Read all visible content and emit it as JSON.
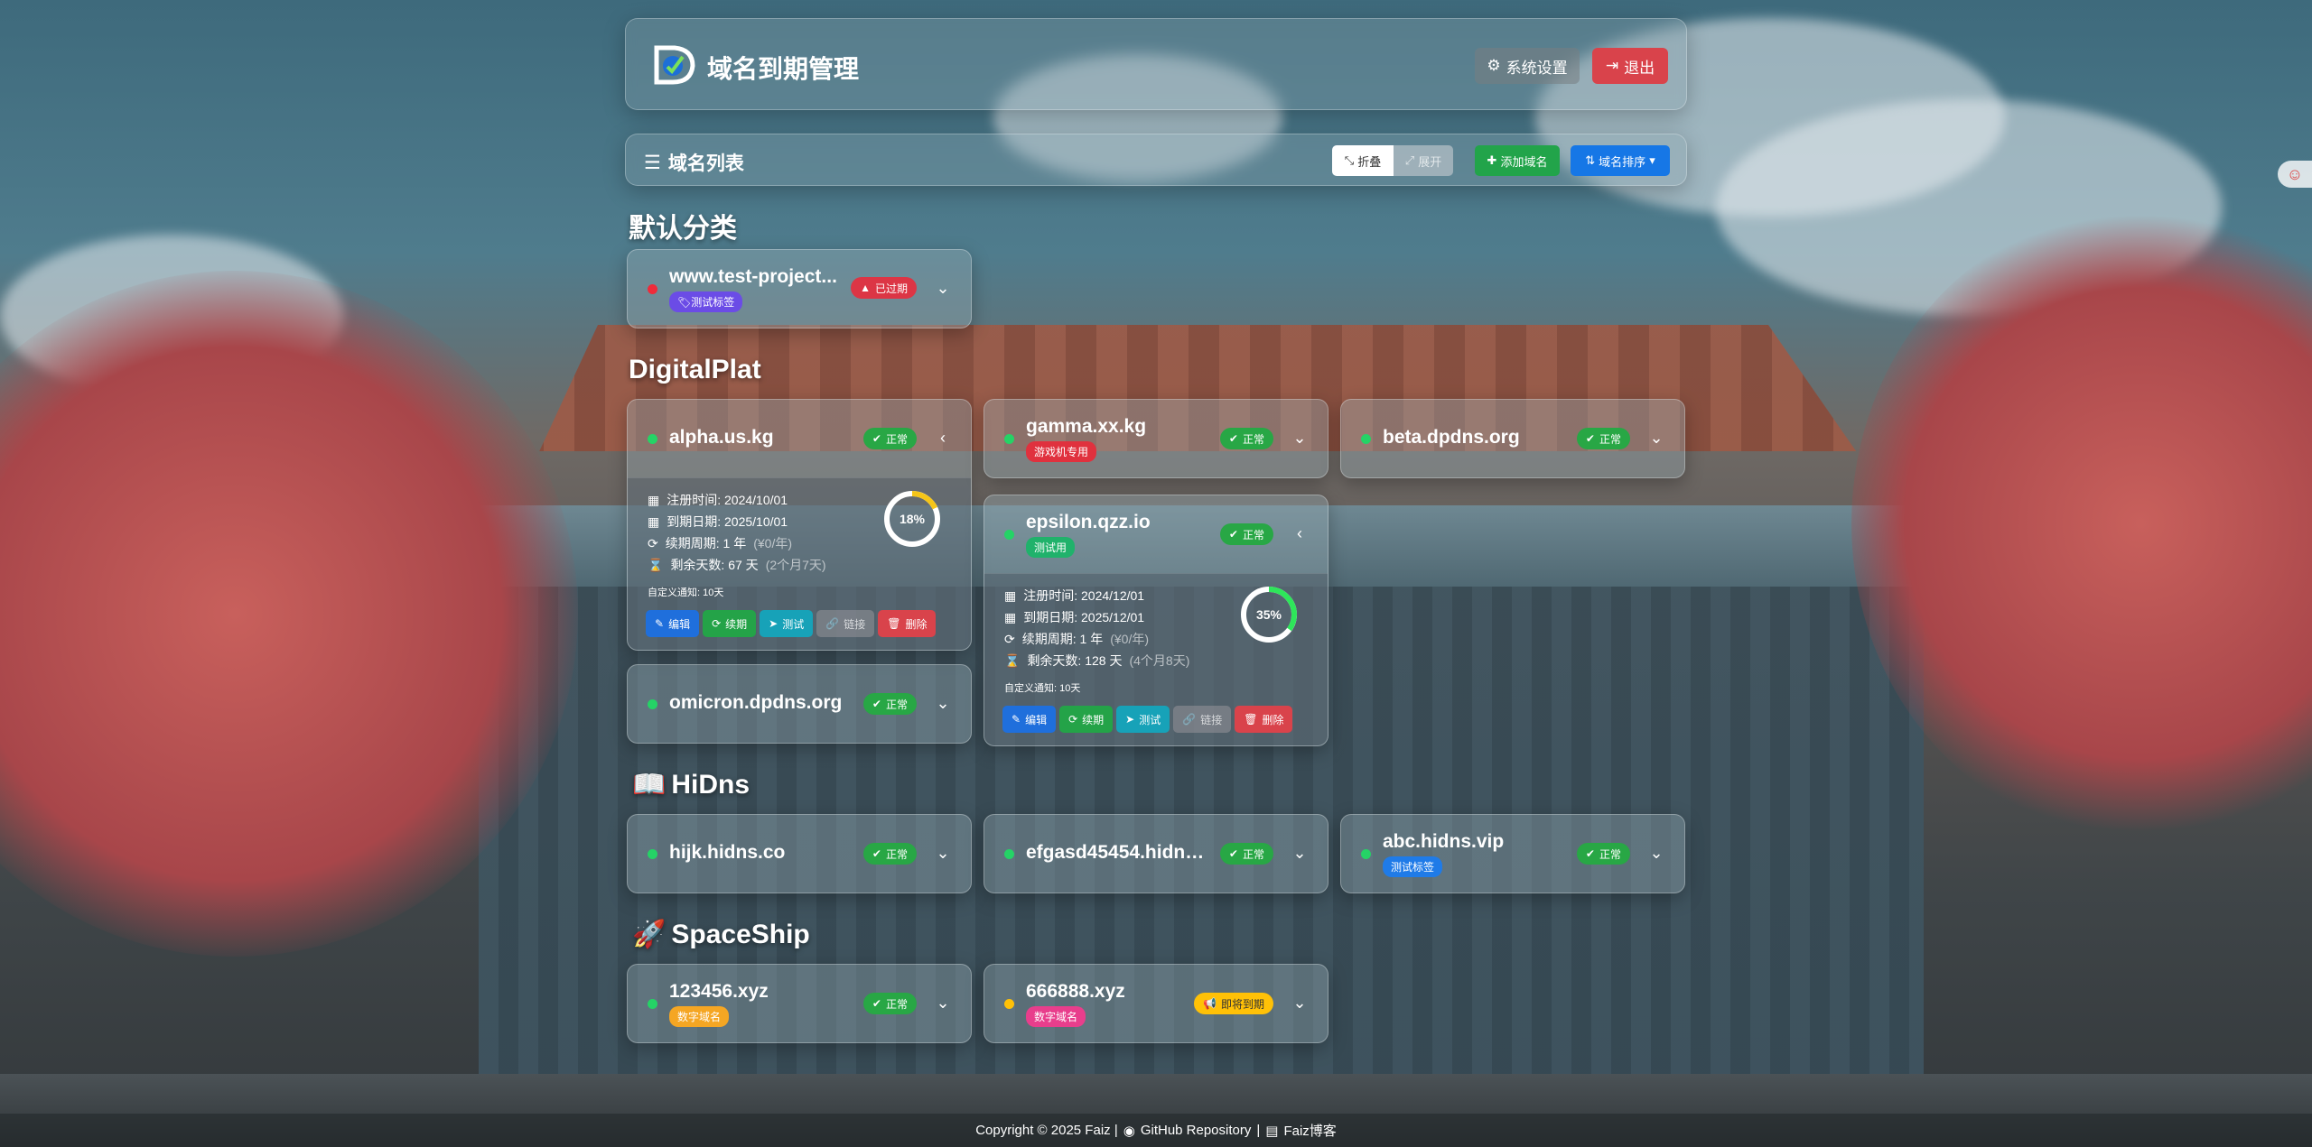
{
  "header": {
    "title": "域名到期管理",
    "settings_label": "系统设置",
    "logout_label": "退出"
  },
  "listbar": {
    "title": "域名列表",
    "collapse_label": "折叠",
    "expand_label": "展开",
    "add_label": "添加域名",
    "sort_label": "域名排序"
  },
  "categories": [
    {
      "name": "默认分类",
      "icon": ""
    },
    {
      "name": "DigitalPlat",
      "icon": ""
    },
    {
      "name": "HiDns",
      "icon": "book-icon"
    },
    {
      "name": "SpaceShip",
      "icon": "rocket-icon"
    }
  ],
  "domains": [
    {
      "name": "www.test-project...",
      "tag": "测试标签",
      "status": "已过期",
      "status_type": "expired"
    },
    {
      "name": "alpha.us.kg",
      "tag": "",
      "status": "正常",
      "status_type": "ok",
      "detail": {
        "reg": "注册时间: 2024/10/01",
        "exp": "到期日期: 2025/10/01",
        "period": "续期周期: 1 年",
        "period_price": "(¥0/年)",
        "remain": "剩余天数: 67 天",
        "remain_extra": "(2个月7天)",
        "notice": "自定义通知: 10天",
        "progress": 18,
        "progress_label": "18%"
      }
    },
    {
      "name": "gamma.xx.kg",
      "tag": "游戏机专用",
      "status": "正常",
      "status_type": "ok"
    },
    {
      "name": "beta.dpdns.org",
      "tag": "",
      "status": "正常",
      "status_type": "ok"
    },
    {
      "name": "epsilon.qzz.io",
      "tag": "测试用",
      "status": "正常",
      "status_type": "ok",
      "detail": {
        "reg": "注册时间: 2024/12/01",
        "exp": "到期日期: 2025/12/01",
        "period": "续期周期: 1 年",
        "period_price": "(¥0/年)",
        "remain": "剩余天数: 128 天",
        "remain_extra": "(4个月8天)",
        "notice": "自定义通知: 10天",
        "progress": 35,
        "progress_label": "35%"
      }
    },
    {
      "name": "omicron.dpdns.org",
      "tag": "",
      "status": "正常",
      "status_type": "ok"
    },
    {
      "name": "hijk.hidns.co",
      "tag": "",
      "status": "正常",
      "status_type": "ok"
    },
    {
      "name": "efgasd45454.hidns...",
      "tag": "",
      "status": "正常",
      "status_type": "ok"
    },
    {
      "name": "abc.hidns.vip",
      "tag": "测试标签",
      "status": "正常",
      "status_type": "ok"
    },
    {
      "name": "123456.xyz",
      "tag": "数字域名",
      "status": "正常",
      "status_type": "ok"
    },
    {
      "name": "666888.xyz",
      "tag": "数字域名",
      "status": "即将到期",
      "status_type": "warn"
    }
  ],
  "actions": {
    "edit": "编辑",
    "renew": "续期",
    "test": "测试",
    "link": "链接",
    "delete": "删除"
  },
  "footer": {
    "copyright": "Copyright © 2025 Faiz |",
    "repo": "GitHub Repository",
    "sep": "|",
    "blog": "Faiz博客"
  },
  "colors": {
    "ok": "#28a745",
    "expired": "#dc3545",
    "warn": "#ffc107",
    "primary": "#1677e6",
    "danger": "#d9434b"
  }
}
